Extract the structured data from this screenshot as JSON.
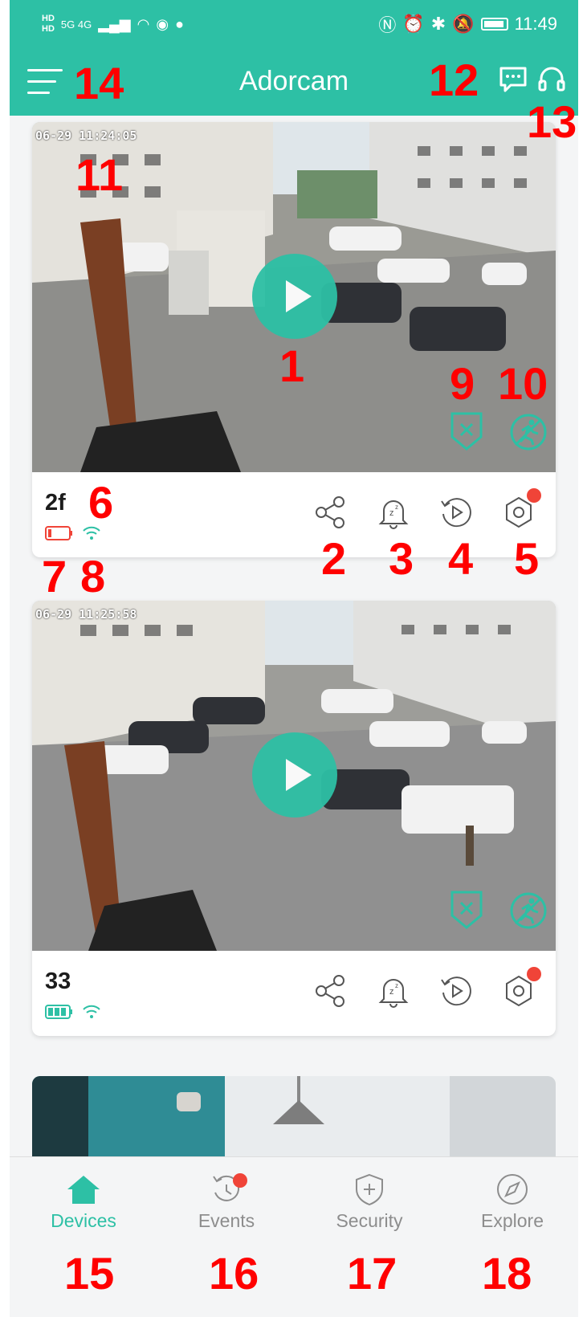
{
  "status_bar": {
    "hd_top": "HD",
    "hd_bottom": "HD",
    "network": "5G 4G",
    "time": "11:49"
  },
  "app_bar": {
    "title": "Adorcam"
  },
  "devices": [
    {
      "name": "2f",
      "timestamp": "06-29 11:24:05",
      "battery_level": "low",
      "battery_color": "#f04438"
    },
    {
      "name": "33",
      "timestamp": "06-29 11:25:58",
      "battery_level": "full",
      "battery_color": "#2dc0a5"
    }
  ],
  "bottom_nav": {
    "tabs": [
      {
        "label": "Devices",
        "icon": "home-icon",
        "active": true
      },
      {
        "label": "Events",
        "icon": "events-icon",
        "active": false
      },
      {
        "label": "Security",
        "icon": "shield-plus-icon",
        "active": false
      },
      {
        "label": "Explore",
        "icon": "compass-icon",
        "active": false
      }
    ]
  },
  "annotations": [
    "1",
    "2",
    "3",
    "4",
    "5",
    "6",
    "7",
    "8",
    "9",
    "10",
    "11",
    "12",
    "13",
    "14",
    "15",
    "16",
    "17",
    "18"
  ],
  "colors": {
    "accent": "#2dc0a5",
    "alert": "#f04438",
    "annotation": "#ff0000"
  }
}
